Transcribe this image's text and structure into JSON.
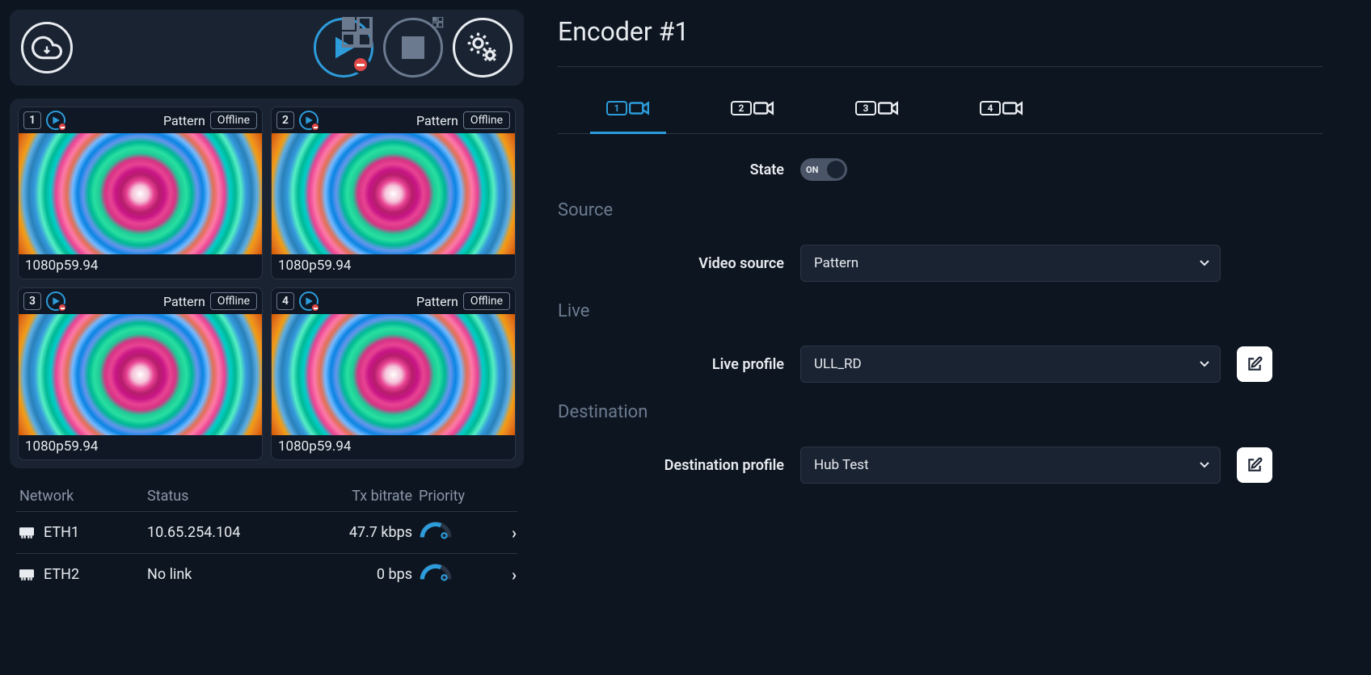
{
  "title": "Encoder #1",
  "encoders": [
    {
      "num": "1",
      "source": "Pattern",
      "status": "Offline",
      "format": "1080p59.94"
    },
    {
      "num": "2",
      "source": "Pattern",
      "status": "Offline",
      "format": "1080p59.94"
    },
    {
      "num": "3",
      "source": "Pattern",
      "status": "Offline",
      "format": "1080p59.94"
    },
    {
      "num": "4",
      "source": "Pattern",
      "status": "Offline",
      "format": "1080p59.94"
    }
  ],
  "network": {
    "headers": {
      "name": "Network",
      "status": "Status",
      "tx": "Tx bitrate",
      "priority": "Priority"
    },
    "rows": [
      {
        "name": "ETH1",
        "status": "10.65.254.104",
        "tx": "47.7 kbps"
      },
      {
        "name": "ETH2",
        "status": "No link",
        "tx": "0 bps"
      }
    ]
  },
  "tabs": [
    "1",
    "2",
    "3",
    "4"
  ],
  "form": {
    "state_label": "State",
    "state_value": "ON",
    "source_section": "Source",
    "video_source_label": "Video source",
    "video_source_value": "Pattern",
    "live_section": "Live",
    "live_profile_label": "Live profile",
    "live_profile_value": "ULL_RD",
    "destination_section": "Destination",
    "destination_profile_label": "Destination profile",
    "destination_profile_value": "Hub Test"
  }
}
